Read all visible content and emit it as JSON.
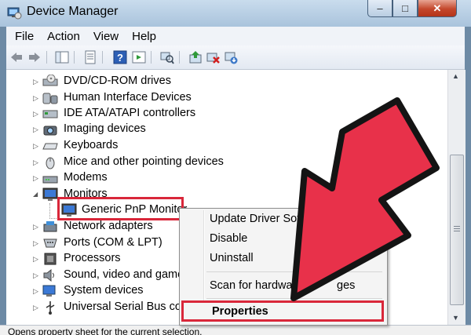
{
  "window": {
    "title": "Device Manager",
    "controls": {
      "minimize": "–",
      "maximize": "□",
      "close": "✕"
    }
  },
  "menubar": {
    "items": [
      "File",
      "Action",
      "View",
      "Help"
    ]
  },
  "toolbar": {
    "buttons": [
      "back-arrow-icon",
      "forward-arrow-icon",
      "console-tree-icon",
      "properties-icon",
      "help-icon",
      "action-pane-icon",
      "scan-hardware-icon",
      "update-driver-icon",
      "uninstall-icon",
      "disable-icon"
    ]
  },
  "tree": {
    "items": [
      {
        "label": "DVD/CD-ROM drives",
        "icon": "dvd-drive-icon"
      },
      {
        "label": "Human Interface Devices",
        "icon": "hid-icon"
      },
      {
        "label": "IDE ATA/ATAPI controllers",
        "icon": "ide-controller-icon"
      },
      {
        "label": "Imaging devices",
        "icon": "camera-icon"
      },
      {
        "label": "Keyboards",
        "icon": "keyboard-icon"
      },
      {
        "label": "Mice and other pointing devices",
        "icon": "mouse-icon"
      },
      {
        "label": "Modems",
        "icon": "modem-icon"
      },
      {
        "label": "Monitors",
        "icon": "monitor-icon"
      },
      {
        "label": "Generic PnP Monitor",
        "icon": "monitor-icon"
      },
      {
        "label": "Network adapters",
        "icon": "network-adapter-icon"
      },
      {
        "label": "Ports (COM & LPT)",
        "icon": "port-icon"
      },
      {
        "label": "Processors",
        "icon": "processor-icon"
      },
      {
        "label": "Sound, video and game",
        "icon": "speaker-icon"
      },
      {
        "label": "System devices",
        "icon": "system-devices-icon"
      },
      {
        "label": "Universal Serial Bus cont",
        "icon": "usb-icon"
      }
    ]
  },
  "context_menu": {
    "items": [
      "Update Driver Softwa",
      "Disable",
      "Uninstall",
      "Scan for hardware",
      "ges",
      "Properties"
    ]
  },
  "status_bar": {
    "text": "Opens property sheet for the current selection."
  },
  "colors": {
    "highlight_red": "#d9273a",
    "arrow_fill": "#e8314a"
  }
}
